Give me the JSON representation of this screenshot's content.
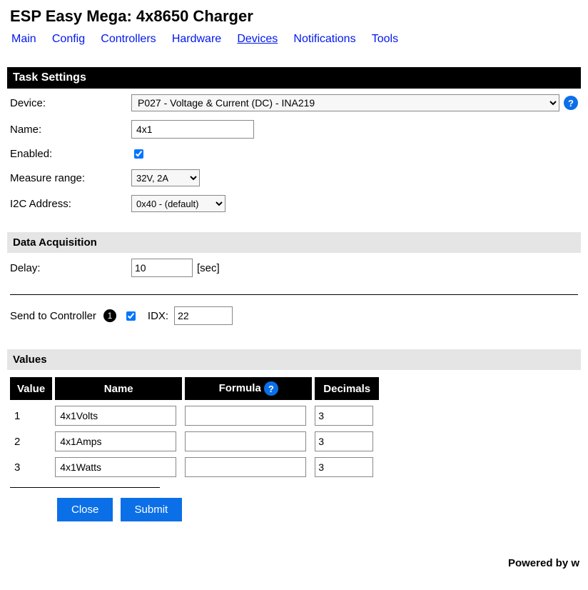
{
  "page_title": "ESP Easy Mega: 4x8650 Charger",
  "nav": {
    "items": [
      "Main",
      "Config",
      "Controllers",
      "Hardware",
      "Devices",
      "Notifications",
      "Tools"
    ],
    "active": "Devices"
  },
  "task_settings": {
    "header": "Task Settings",
    "device_label": "Device:",
    "device_value": "P027 - Voltage & Current (DC) - INA219",
    "name_label": "Name:",
    "name_value": "4x1",
    "enabled_label": "Enabled:",
    "enabled_checked": true,
    "range_label": "Measure range:",
    "range_value": "32V, 2A",
    "i2c_label": "I2C Address:",
    "i2c_value": "0x40 - (default)"
  },
  "data_acq": {
    "header": "Data Acquisition",
    "delay_label": "Delay:",
    "delay_value": "10",
    "delay_unit": "[sec]"
  },
  "controller": {
    "label": "Send to Controller",
    "badge": "1",
    "checked": true,
    "idx_label": "IDX:",
    "idx_value": "22"
  },
  "values_section": {
    "header": "Values",
    "col_value": "Value",
    "col_name": "Name",
    "col_formula": "Formula",
    "col_decimals": "Decimals",
    "rows": [
      {
        "idx": "1",
        "name": "4x1Volts",
        "formula": "",
        "decimals": "3"
      },
      {
        "idx": "2",
        "name": "4x1Amps",
        "formula": "",
        "decimals": "3"
      },
      {
        "idx": "3",
        "name": "4x1Watts",
        "formula": "",
        "decimals": "3"
      }
    ]
  },
  "buttons": {
    "close": "Close",
    "submit": "Submit"
  },
  "footer": "Powered by w",
  "help_glyph": "?"
}
